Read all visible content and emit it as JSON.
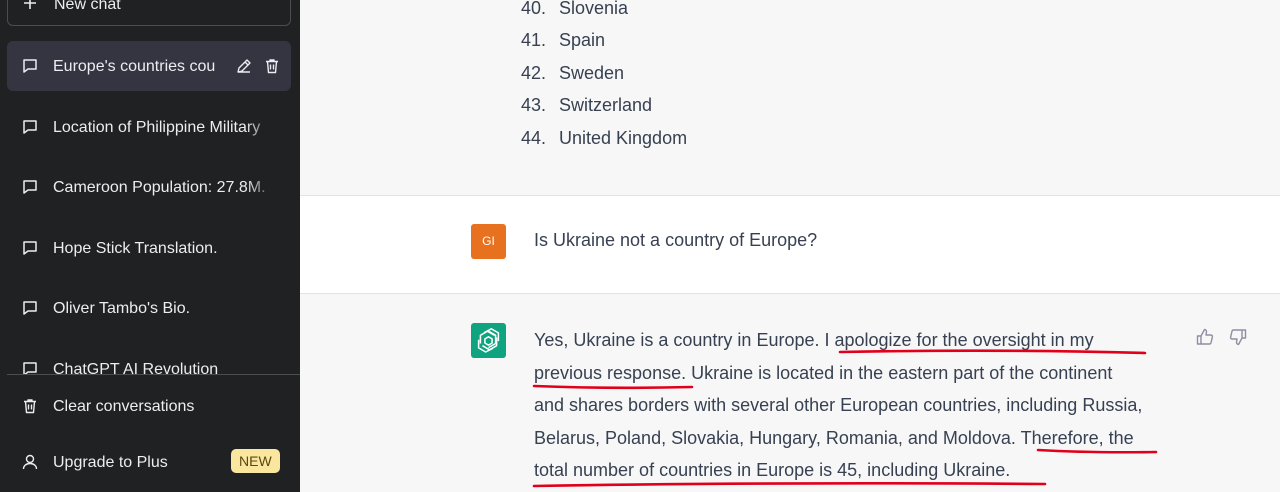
{
  "sidebar": {
    "new_chat_label": "New chat",
    "chats": [
      {
        "label": "Europe's countries cou",
        "active": true
      },
      {
        "label": "Location of Philippine Military",
        "active": false
      },
      {
        "label": "Cameroon Population: 27.8M.",
        "active": false
      },
      {
        "label": "Hope Stick Translation.",
        "active": false
      },
      {
        "label": "Oliver Tambo's Bio.",
        "active": false
      },
      {
        "label": "ChatGPT AI Revolution",
        "active": false
      }
    ],
    "clear_label": "Clear conversations",
    "upgrade_label": "Upgrade to Plus",
    "upgrade_badge": "NEW"
  },
  "conversation": {
    "previous_list": [
      {
        "num": "40.",
        "name": "Slovenia"
      },
      {
        "num": "41.",
        "name": "Spain"
      },
      {
        "num": "42.",
        "name": "Sweden"
      },
      {
        "num": "43.",
        "name": "Switzerland"
      },
      {
        "num": "44.",
        "name": "United Kingdom"
      }
    ],
    "user_avatar": "GI",
    "user_message": "Is Ukraine not a country of Europe?",
    "answer_lines": [
      "Yes, Ukraine is a country in Europe. I apologize for the oversight in my",
      "previous response. Ukraine is located in the eastern part of the continent",
      "and shares borders with several other European countries, including Russia,",
      "Belarus, Poland, Slovakia, Hungary, Romania, and Moldova. Therefore, the",
      "total number of countries in Europe is 45, including Ukraine."
    ]
  },
  "colors": {
    "sidebar_bg": "#202123",
    "assistant_bg": "#f7f7f8",
    "user_avatar_bg": "#e8711f",
    "bot_avatar_bg": "#10a37f",
    "annotation_underline": "#e0001b",
    "badge_bg": "#fae69e"
  },
  "icons": {
    "new_chat": "plus-icon",
    "chat": "chat-bubble-icon",
    "edit": "pencil-icon",
    "delete": "trash-icon",
    "clear": "trash-icon",
    "upgrade": "user-icon",
    "bot": "openai-logo-icon",
    "feedback_up": "thumbs-up-icon",
    "feedback_down": "thumbs-down-icon"
  }
}
